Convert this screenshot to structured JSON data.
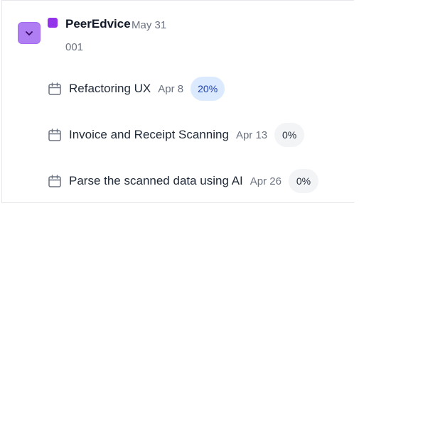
{
  "project": {
    "name": "PeerEdvice",
    "date": "May 31",
    "id": "001",
    "color": "#9333ea",
    "toggle_icon": "chevron-down-icon"
  },
  "tasks": [
    {
      "title": "Refactoring UX",
      "date": "Apr 8",
      "progress": "20%",
      "icon": "calendar-icon"
    },
    {
      "title": "Invoice and Receipt Scanning",
      "date": "Apr 13",
      "progress": "0%",
      "icon": "calendar-icon"
    },
    {
      "title": "Parse the scanned data using AI",
      "date": "Apr 26",
      "progress": "0%",
      "icon": "calendar-icon"
    }
  ]
}
